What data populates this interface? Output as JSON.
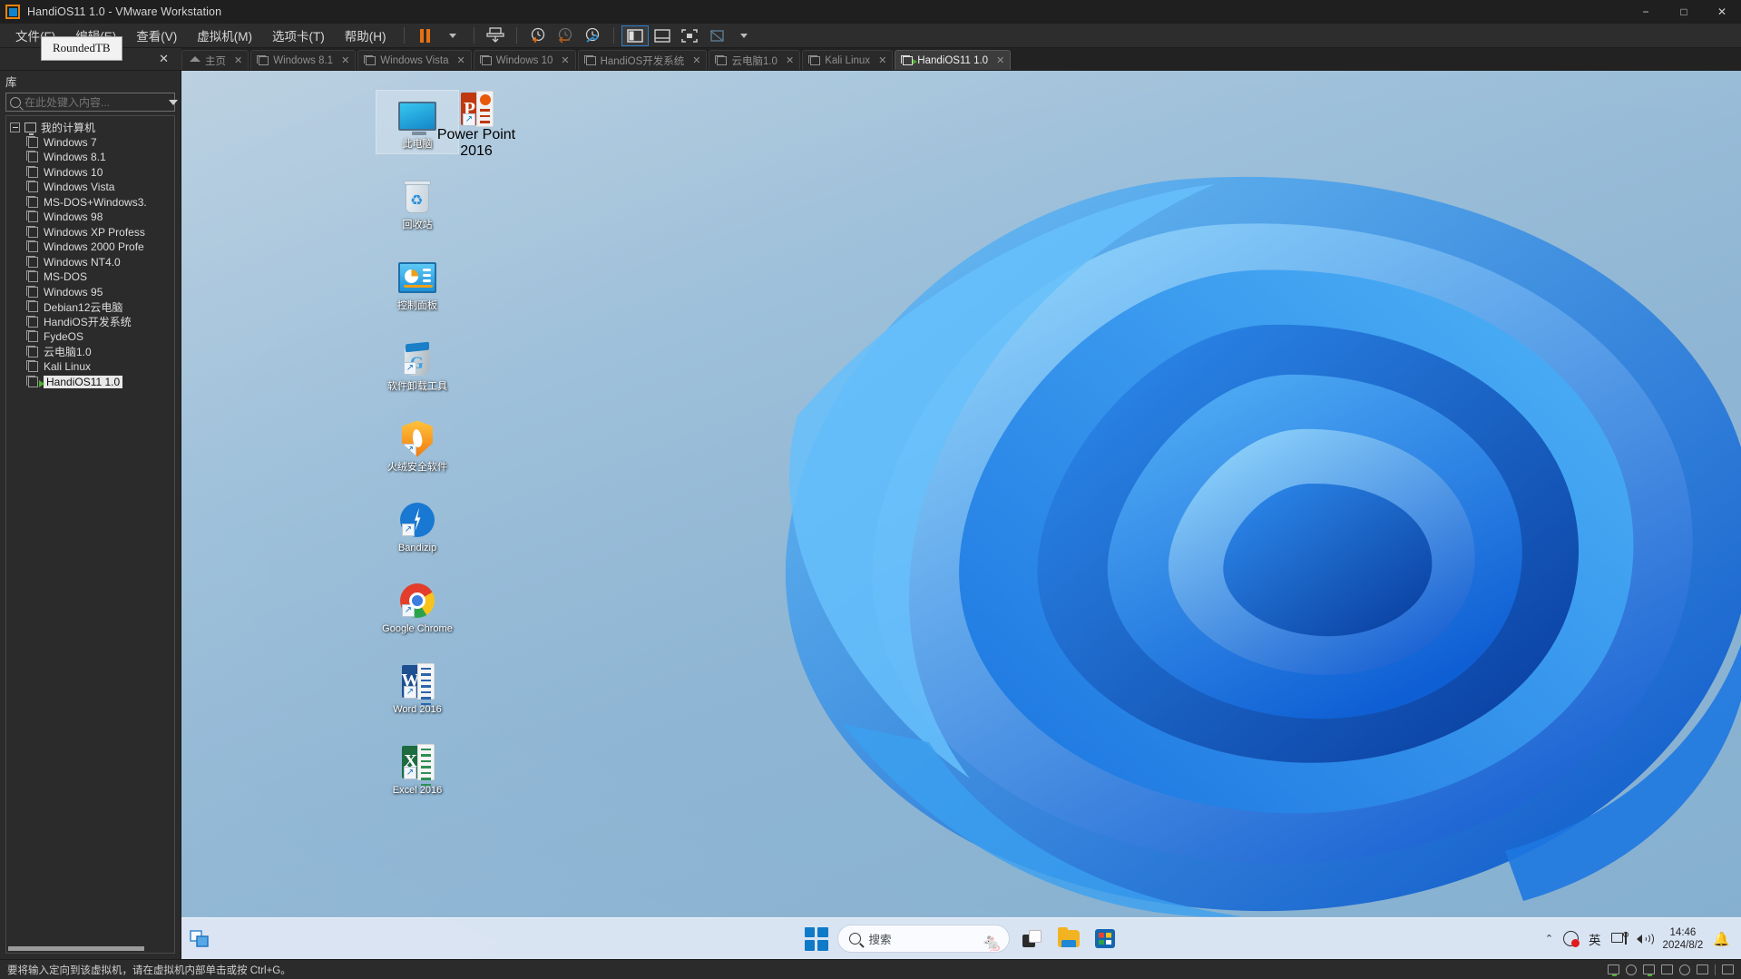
{
  "window": {
    "title": "HandiOS11 1.0 - VMware Workstation",
    "app_icon": "vmware-logo-icon",
    "controls": {
      "minimize": "−",
      "maximize": "□",
      "close": "✕"
    }
  },
  "tooltip": {
    "text": "RoundedTB"
  },
  "menubar": {
    "items": [
      {
        "label": "文件(F)",
        "name": "menu-file"
      },
      {
        "label": "编辑(E)",
        "name": "menu-edit"
      },
      {
        "label": "查看(V)",
        "name": "menu-view"
      },
      {
        "label": "虚拟机(M)",
        "name": "menu-vm"
      },
      {
        "label": "选项卡(T)",
        "name": "menu-tabs"
      },
      {
        "label": "帮助(H)",
        "name": "menu-help"
      }
    ],
    "toolbar": [
      {
        "name": "suspend-button",
        "icon": "pause-icon"
      },
      {
        "name": "power-dropdown",
        "icon": "chevron-down-icon"
      },
      {
        "name": "snapshot-button",
        "icon": "snapshot-icon"
      },
      {
        "name": "take-snapshot-button",
        "icon": "clock-plus-icon"
      },
      {
        "name": "revert-snapshot-button",
        "icon": "clock-back-icon"
      },
      {
        "name": "snapshot-manager-button",
        "icon": "clock-wrench-icon"
      },
      {
        "name": "show-library-button",
        "icon": "panel-left-icon"
      },
      {
        "name": "show-thumbnail-button",
        "icon": "panel-bottom-icon"
      },
      {
        "name": "fullscreen-button",
        "icon": "fullscreen-icon"
      },
      {
        "name": "unity-button",
        "icon": "unity-icon"
      },
      {
        "name": "unity-dropdown",
        "icon": "chevron-down-icon"
      }
    ]
  },
  "library": {
    "title": "库",
    "close": "✕",
    "search_placeholder": "在此处键入内容...",
    "search_value": "",
    "root": {
      "label": "我的计算机",
      "icon": "my-computer-icon"
    },
    "items": [
      {
        "label": "Windows 7",
        "running": false
      },
      {
        "label": "Windows 8.1",
        "running": false
      },
      {
        "label": "Windows 10",
        "running": false
      },
      {
        "label": "Windows Vista",
        "running": false
      },
      {
        "label": "MS-DOS+Windows3.",
        "running": false
      },
      {
        "label": "Windows 98",
        "running": false
      },
      {
        "label": "Windows XP Profess",
        "running": false
      },
      {
        "label": "Windows 2000 Profe",
        "running": false
      },
      {
        "label": "Windows NT4.0",
        "running": false
      },
      {
        "label": "MS-DOS",
        "running": false
      },
      {
        "label": "Windows 95",
        "running": false
      },
      {
        "label": "Debian12云电脑",
        "running": false
      },
      {
        "label": "HandiOS开发系统",
        "running": false
      },
      {
        "label": "FydeOS",
        "running": false
      },
      {
        "label": "云电脑1.0",
        "running": false
      },
      {
        "label": "Kali Linux",
        "running": false
      },
      {
        "label": "HandiOS11 1.0",
        "running": true,
        "selected": true
      }
    ]
  },
  "tabs": [
    {
      "label": "主页",
      "icon": "home-icon",
      "active": false,
      "closable": true
    },
    {
      "label": "Windows 8.1",
      "icon": "vm-icon",
      "active": false,
      "closable": true
    },
    {
      "label": "Windows Vista",
      "icon": "vm-icon",
      "active": false,
      "closable": true
    },
    {
      "label": "Windows 10",
      "icon": "vm-icon",
      "active": false,
      "closable": true
    },
    {
      "label": "HandiOS开发系统",
      "icon": "vm-icon",
      "active": false,
      "closable": true
    },
    {
      "label": "云电脑1.0",
      "icon": "vm-icon",
      "active": false,
      "closable": true
    },
    {
      "label": "Kali Linux",
      "icon": "vm-icon",
      "active": false,
      "closable": true
    },
    {
      "label": "HandiOS11 1.0",
      "icon": "vm-running-icon",
      "active": true,
      "closable": true
    }
  ],
  "desktop": {
    "icons": [
      {
        "label": "此电脑",
        "art": "monitor",
        "selected": true,
        "shortcut": false
      },
      {
        "label": "回收站",
        "art": "recycle-bin",
        "selected": false,
        "shortcut": false
      },
      {
        "label": "控制面板",
        "art": "control-panel",
        "selected": false,
        "shortcut": false
      },
      {
        "label": "软件卸载工具",
        "art": "uninstaller",
        "selected": false,
        "shortcut": true
      },
      {
        "label": "火绒安全软件",
        "art": "huorong",
        "selected": false,
        "shortcut": true
      },
      {
        "label": "Bandizip",
        "art": "bandizip",
        "selected": false,
        "shortcut": true
      },
      {
        "label": "Google Chrome",
        "art": "chrome",
        "selected": false,
        "shortcut": true
      },
      {
        "label": "Word 2016",
        "art": "word",
        "selected": false,
        "shortcut": true
      },
      {
        "label": "Excel 2016",
        "art": "excel",
        "selected": false,
        "shortcut": true
      }
    ],
    "second_column": [
      {
        "label": "Power Point 2016",
        "art": "powerpoint",
        "selected": false,
        "shortcut": true
      }
    ]
  },
  "taskbar": {
    "leftmost_app": "vm-grabber-icon",
    "start_label": "开始",
    "search": {
      "placeholder": "搜索",
      "value": "",
      "illustration": "🐁"
    },
    "apps": [
      {
        "name": "task-view-button",
        "icon": "task-view-icon"
      },
      {
        "name": "file-explorer-button",
        "icon": "folder-icon"
      },
      {
        "name": "microsoft-store-button",
        "icon": "store-icon"
      }
    ],
    "tray": {
      "chevron": "⌃",
      "recording_icon": "screen-record-icon",
      "ime": "英",
      "network_icon": "network-icon",
      "volume_icon": "volume-icon",
      "time": "14:46",
      "date": "2024/8/2",
      "notification_icon": "bell-icon"
    }
  },
  "statusbar": {
    "message": "要将输入定向到该虚拟机，请在虚拟机内部单击或按 Ctrl+G。",
    "icons": [
      "hard-disk-icon",
      "cd-dvd-icon",
      "network-adapter-icon",
      "sound-card-icon",
      "usb-icon",
      "printer-icon",
      "display-icon"
    ]
  },
  "colors": {
    "accent_orange": "#e8700f",
    "accent_blue": "#0f85d0",
    "chrome_dark": "#2b2b2b",
    "titlebar": "#1f1f1f",
    "taskbar": "#dee7f4",
    "desktop_blue": "#1e7fd0"
  }
}
